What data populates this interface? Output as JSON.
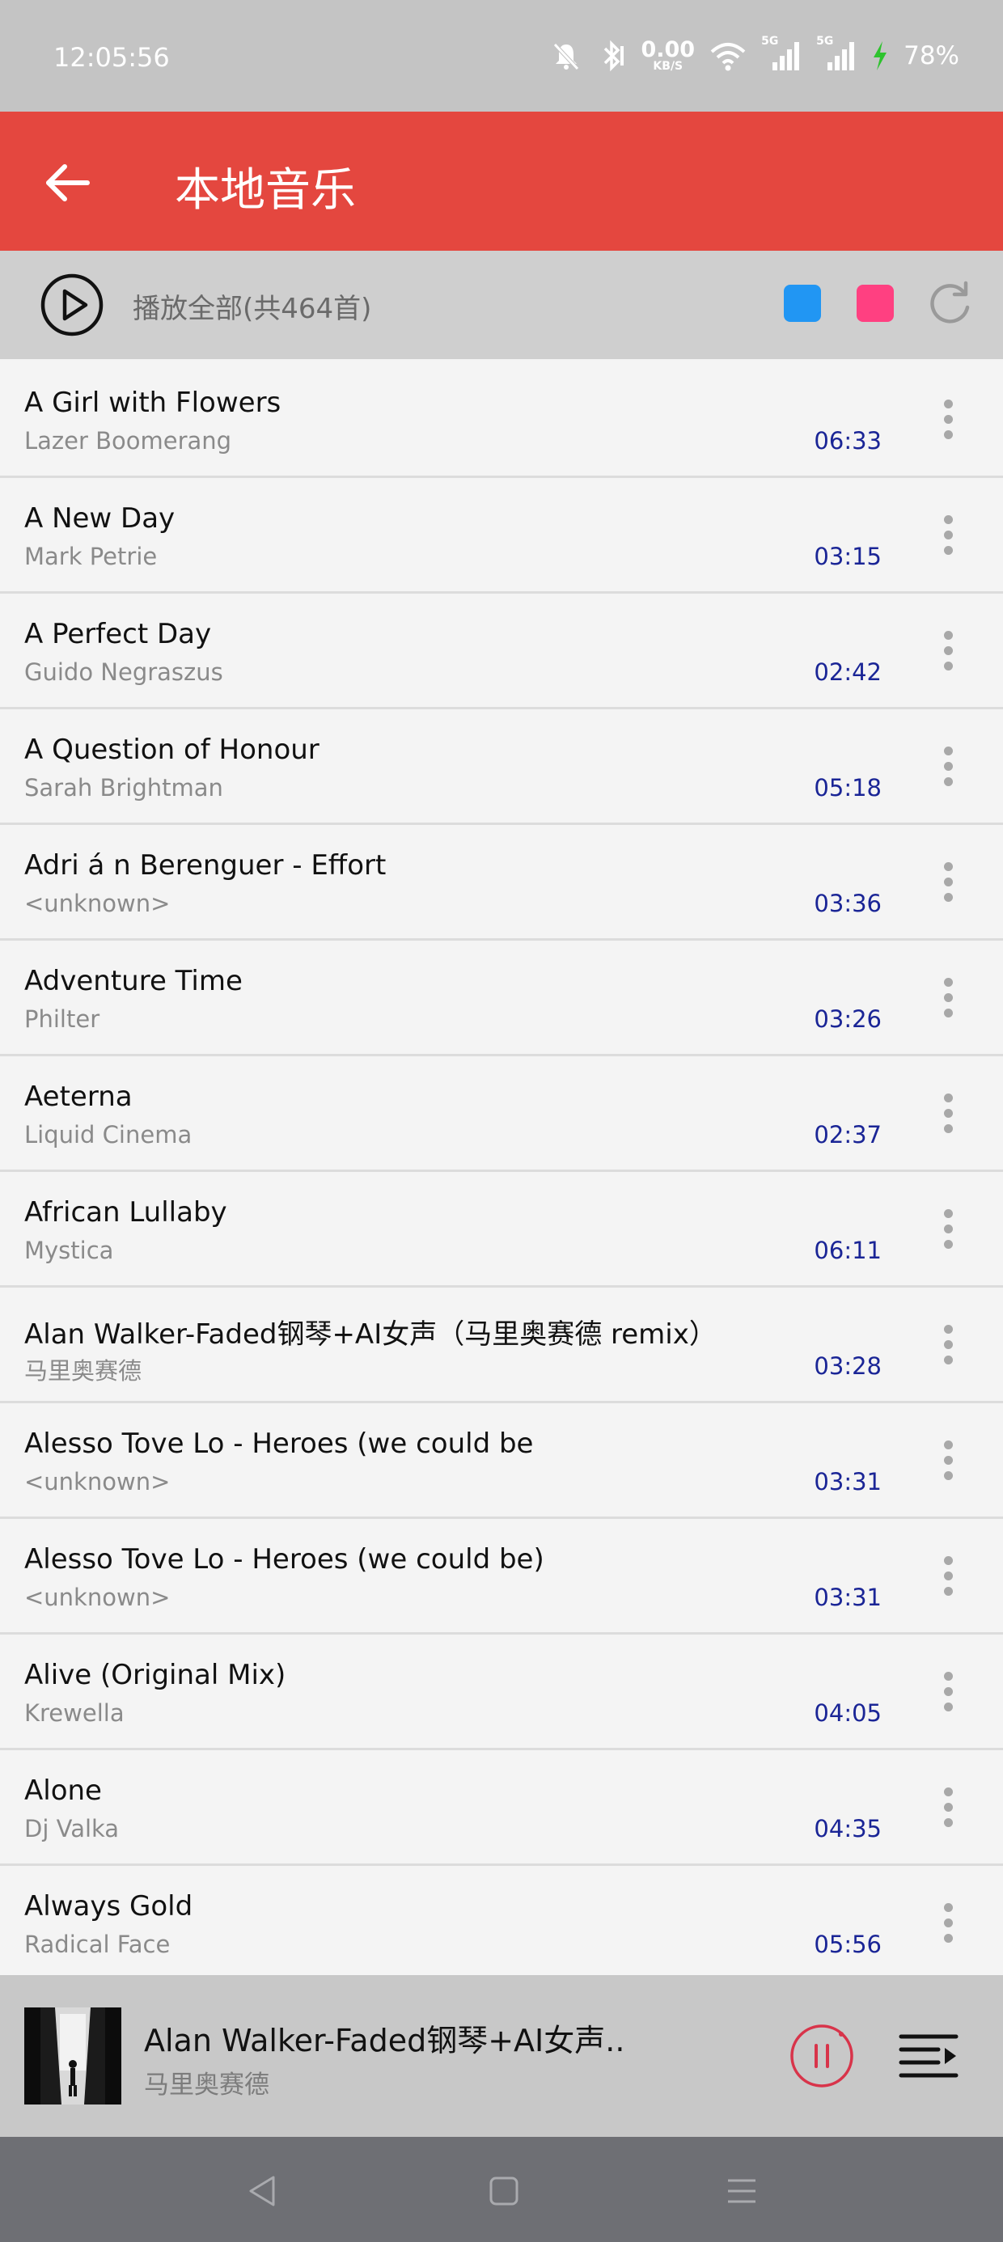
{
  "status": {
    "time": "12:05:56",
    "net_speed_value": "0.00",
    "net_speed_unit": "KB/S",
    "signal1_label": "5G",
    "signal2_label": "5G",
    "battery": "78%"
  },
  "header": {
    "title": "本地音乐",
    "back_icon": "arrow-left-icon"
  },
  "play_all": {
    "label": "播放全部(共464首)",
    "color_options": [
      "#2196f3",
      "#ff4081"
    ]
  },
  "songs": [
    {
      "title": "A Girl with Flowers",
      "artist": "Lazer Boomerang",
      "duration": "06:33"
    },
    {
      "title": "A New Day",
      "artist": "Mark Petrie",
      "duration": "03:15"
    },
    {
      "title": "A Perfect Day",
      "artist": "Guido Negraszus",
      "duration": "02:42"
    },
    {
      "title": "A Question of Honour",
      "artist": "Sarah Brightman",
      "duration": "05:18"
    },
    {
      "title": "Adri á n Berenguer - Effort",
      "artist": "<unknown>",
      "duration": "03:36"
    },
    {
      "title": "Adventure Time",
      "artist": "Philter",
      "duration": "03:26"
    },
    {
      "title": "Aeterna",
      "artist": "Liquid Cinema",
      "duration": "02:37"
    },
    {
      "title": "African Lullaby",
      "artist": "Mystica",
      "duration": "06:11"
    },
    {
      "title": "Alan Walker-Faded钢琴+AI女声（马里奥赛德 remix）",
      "artist": "马里奥赛德",
      "duration": "03:28"
    },
    {
      "title": "Alesso Tove Lo - Heroes (we could be",
      "artist": "<unknown>",
      "duration": "03:31"
    },
    {
      "title": "Alesso Tove Lo - Heroes (we could be)",
      "artist": "<unknown>",
      "duration": "03:31"
    },
    {
      "title": "Alive (Original Mix)",
      "artist": "Krewella",
      "duration": "04:05"
    },
    {
      "title": "Alone",
      "artist": "Dj Valka",
      "duration": "04:35"
    },
    {
      "title": "Always Gold",
      "artist": "Radical Face",
      "duration": "05:56"
    }
  ],
  "now_playing": {
    "title": "Alan Walker-Faded钢琴+AI女声..",
    "artist": "马里奥赛德",
    "state": "playing"
  },
  "colors": {
    "accent": "#e4473f",
    "duration_text": "#1a2596",
    "pause_button": "#d8344a"
  }
}
